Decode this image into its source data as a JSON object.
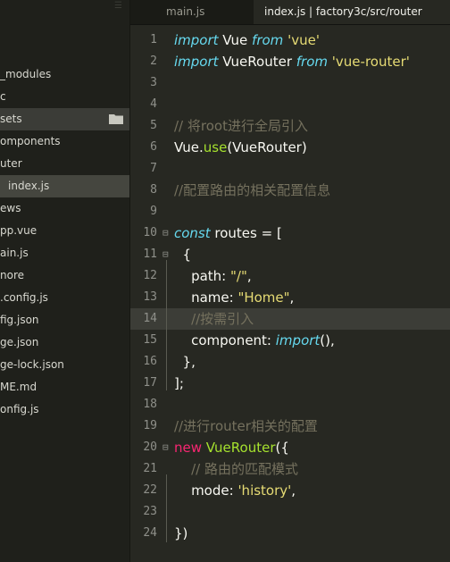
{
  "sidebar": {
    "items": [
      {
        "label": "_modules",
        "indent": 0
      },
      {
        "label": "c",
        "indent": 0
      },
      {
        "label": "sets",
        "indent": 0
      },
      {
        "label": "omponents",
        "indent": 0
      },
      {
        "label": "uter",
        "indent": 0
      },
      {
        "label": "index.js",
        "indent": 1
      },
      {
        "label": "ews",
        "indent": 0
      },
      {
        "label": "pp.vue",
        "indent": 0
      },
      {
        "label": "ain.js",
        "indent": 0
      },
      {
        "label": "nore",
        "indent": 0
      },
      {
        "label": ".config.js",
        "indent": 0
      },
      {
        "label": "fig.json",
        "indent": 0
      },
      {
        "label": "ge.json",
        "indent": 0
      },
      {
        "label": "ge-lock.json",
        "indent": 0
      },
      {
        "label": "ME.md",
        "indent": 0
      },
      {
        "label": "onfig.js",
        "indent": 0
      }
    ],
    "highlighted_index": 2,
    "selected_index": 5,
    "folder_icon": "folder-icon"
  },
  "tabs": [
    {
      "label": "main.js",
      "active": false
    },
    {
      "label": "index.js | factory3c/src/router",
      "active": true
    }
  ],
  "editor": {
    "highlighted_line": 14,
    "lines": [
      {
        "n": "1",
        "fold": "",
        "tokens": [
          [
            "kw",
            "import"
          ],
          [
            "p",
            " Vue "
          ],
          [
            "kw",
            "from"
          ],
          [
            "p",
            " "
          ],
          [
            "str",
            "'vue'"
          ]
        ]
      },
      {
        "n": "2",
        "fold": "",
        "tokens": [
          [
            "kw",
            "import"
          ],
          [
            "p",
            " VueRouter "
          ],
          [
            "kw",
            "from"
          ],
          [
            "p",
            " "
          ],
          [
            "str",
            "'vue-router'"
          ]
        ]
      },
      {
        "n": "3",
        "fold": "",
        "tokens": []
      },
      {
        "n": "4",
        "fold": "",
        "tokens": []
      },
      {
        "n": "5",
        "fold": "",
        "tokens": [
          [
            "cm",
            "// 将root进行全局引入"
          ]
        ]
      },
      {
        "n": "6",
        "fold": "",
        "tokens": [
          [
            "p",
            "Vue."
          ],
          [
            "fn",
            "use"
          ],
          [
            "p",
            "(VueRouter)"
          ]
        ]
      },
      {
        "n": "7",
        "fold": "",
        "tokens": []
      },
      {
        "n": "8",
        "fold": "",
        "tokens": [
          [
            "cm",
            "//配置路由的相关配置信息"
          ]
        ]
      },
      {
        "n": "9",
        "fold": "",
        "tokens": []
      },
      {
        "n": "10",
        "fold": "⊟",
        "tokens": [
          [
            "kw",
            "const"
          ],
          [
            "p",
            " routes = ["
          ]
        ]
      },
      {
        "n": "11",
        "fold": "⊟",
        "tokens": [
          [
            "p",
            "  {"
          ]
        ]
      },
      {
        "n": "12",
        "fold": "",
        "tokens": [
          [
            "p",
            "    path: "
          ],
          [
            "str",
            "\"/\""
          ],
          [
            "p",
            ","
          ]
        ]
      },
      {
        "n": "13",
        "fold": "",
        "tokens": [
          [
            "p",
            "    name: "
          ],
          [
            "str",
            "\"Home\""
          ],
          [
            "p",
            ","
          ]
        ]
      },
      {
        "n": "14",
        "fold": "",
        "tokens": [
          [
            "p",
            "    "
          ],
          [
            "cm",
            "//按需引入"
          ]
        ]
      },
      {
        "n": "15",
        "fold": "",
        "tokens": [
          [
            "p",
            "    component: "
          ],
          [
            "kw",
            "import"
          ],
          [
            "p",
            "(),"
          ]
        ]
      },
      {
        "n": "16",
        "fold": "",
        "tokens": [
          [
            "p",
            "  },"
          ]
        ]
      },
      {
        "n": "17",
        "fold": "",
        "tokens": [
          [
            "p",
            "];"
          ]
        ]
      },
      {
        "n": "18",
        "fold": "",
        "tokens": []
      },
      {
        "n": "19",
        "fold": "",
        "tokens": [
          [
            "cm",
            "//进行router相关的配置"
          ]
        ]
      },
      {
        "n": "20",
        "fold": "⊟",
        "tokens": [
          [
            "red",
            "new"
          ],
          [
            "p",
            " "
          ],
          [
            "fn",
            "VueRouter"
          ],
          [
            "p",
            "({"
          ]
        ]
      },
      {
        "n": "21",
        "fold": "",
        "tokens": [
          [
            "p",
            "    "
          ],
          [
            "cm",
            "// 路由的匹配模式"
          ]
        ]
      },
      {
        "n": "22",
        "fold": "",
        "tokens": [
          [
            "p",
            "    mode: "
          ],
          [
            "str",
            "'history'"
          ],
          [
            "p",
            ","
          ]
        ]
      },
      {
        "n": "23",
        "fold": "",
        "tokens": []
      },
      {
        "n": "24",
        "fold": "",
        "tokens": [
          [
            "p",
            "})"
          ]
        ]
      }
    ]
  },
  "colors": {
    "background": "#272822",
    "sidebar": "#1f201b",
    "keyword": "#66d9ef",
    "string": "#e6db74",
    "comment": "#75715e",
    "function": "#a6e22e",
    "red_keyword": "#f92672"
  }
}
